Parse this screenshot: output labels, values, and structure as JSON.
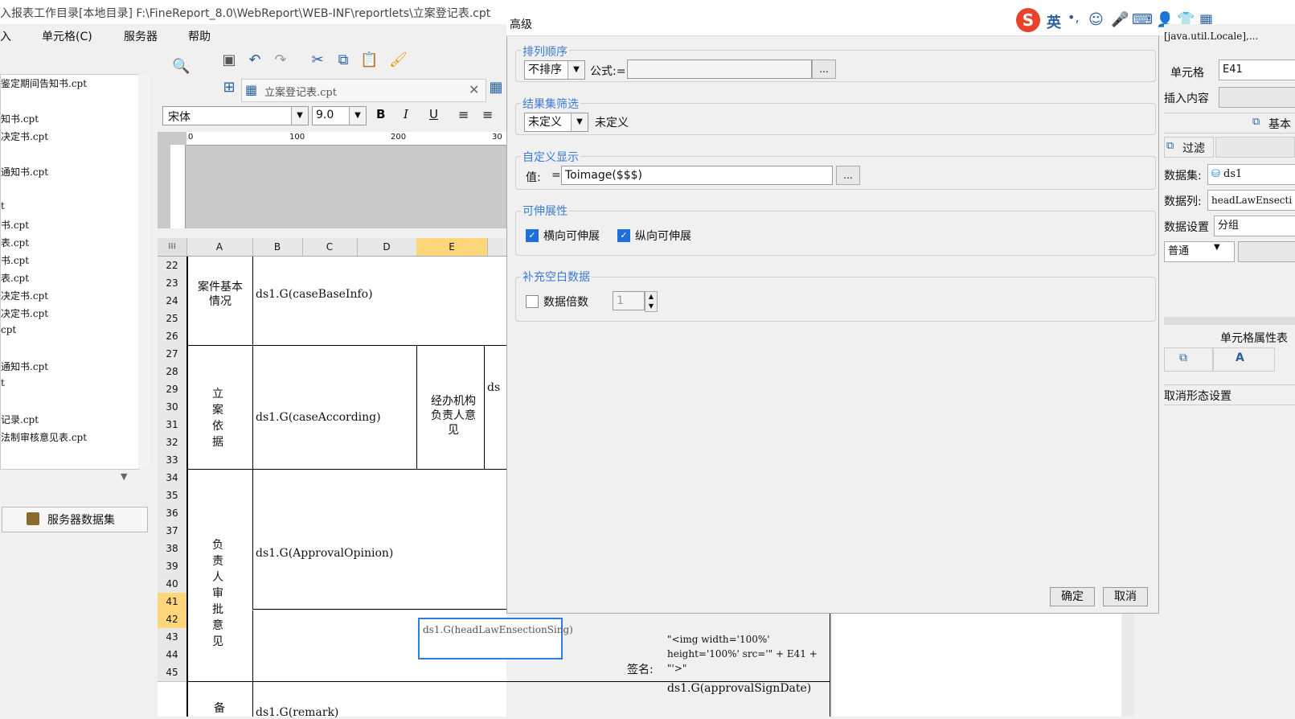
{
  "window": {
    "title": "入报表工作目录[本地目录]    F:\\FineReport_8.0\\WebReport\\WEB-INF\\reportlets\\立案登记表.cpt"
  },
  "menu": [
    "入",
    "单元格(C)",
    "服务器",
    "帮助"
  ],
  "files": [
    "鉴定期间告知书.cpt",
    "知书.cpt",
    "决定书.cpt",
    "通知书.cpt",
    "t",
    "书.cpt",
    "表.cpt",
    "书.cpt",
    "表.cpt",
    "决定书.cpt",
    "决定书.cpt",
    "cpt",
    "通知书.cpt",
    "t",
    "记录.cpt",
    "法制审核意见表.cpt"
  ],
  "server_dataset_button": "服务器数据集",
  "tab": {
    "label": "立案登记表.cpt"
  },
  "font": {
    "family": "宋体",
    "size": "9.0"
  },
  "format_buttons": [
    "B",
    "I",
    "U"
  ],
  "ruler_marks": [
    "0",
    "100",
    "200",
    "30"
  ],
  "columns": [
    "A",
    "B",
    "C",
    "D",
    "E"
  ],
  "rows": [
    "22",
    "23",
    "24",
    "25",
    "26",
    "27",
    "28",
    "29",
    "30",
    "31",
    "32",
    "33",
    "34",
    "35",
    "36",
    "37",
    "38",
    "39",
    "40",
    "41",
    "42",
    "43",
    "44",
    "45"
  ],
  "cells": {
    "case_basic": "案件基本情况",
    "case_base_formula": "ds1.G(caseBaseInfo)",
    "filing_basis": "立案依据",
    "case_according_formula": "ds1.G(caseAccording)",
    "handler_opinion": "经办机构负责人意见",
    "ds_clip": "ds",
    "approval_label": "负责人审批意见",
    "approval_formula": "ds1.G(ApprovalOpinion)",
    "e41_formula": "ds1.G(headLawEnsectionSing)",
    "img_formula": "\"<img width='100%' height='100%' src='\" + E41 + \"'>\"",
    "sign_label": "签名:",
    "sign_date_formula": "ds1.G(approvalSignDate)",
    "remark_label": "备",
    "remark_formula": "ds1.G(remark)"
  },
  "dialog": {
    "title": "高级",
    "sort": {
      "label": "排列顺序",
      "selected": "不排序",
      "formula_label": "公式:=",
      "formula_value": ""
    },
    "filter": {
      "label": "结果集筛选",
      "selected": "未定义",
      "text": "未定义"
    },
    "custom": {
      "label": "自定义显示",
      "value_label": "值:",
      "eq": "=",
      "value": "Toimage($$$)"
    },
    "expand": {
      "label": "可伸展性",
      "horizontal": "横向可伸展",
      "vertical": "纵向可伸展"
    },
    "fill": {
      "label": "补充空白数据",
      "multiple_label": "数据倍数",
      "multiple_value": "1"
    },
    "ok": "确定",
    "cancel": "取消",
    "ellipsis": "..."
  },
  "ime": {
    "lang": "英",
    "punct": "•,"
  },
  "right_panel": {
    "locale_text": "[java.util.Locale],...",
    "cell_label": "单元格",
    "cell_value": "E41",
    "insert_label": "插入内容",
    "basic_tab": "基本",
    "filter_tab": "过滤",
    "dataset_label": "数据集:",
    "dataset_value": "ds1",
    "datacol_label": "数据列:",
    "datacol_value": "headLawEnsecti",
    "datasetting_label": "数据设置",
    "datasetting_value": "分组",
    "mode_value": "普通",
    "attr_title": "单元格属性表",
    "cancel_form": "取消形态设置"
  }
}
